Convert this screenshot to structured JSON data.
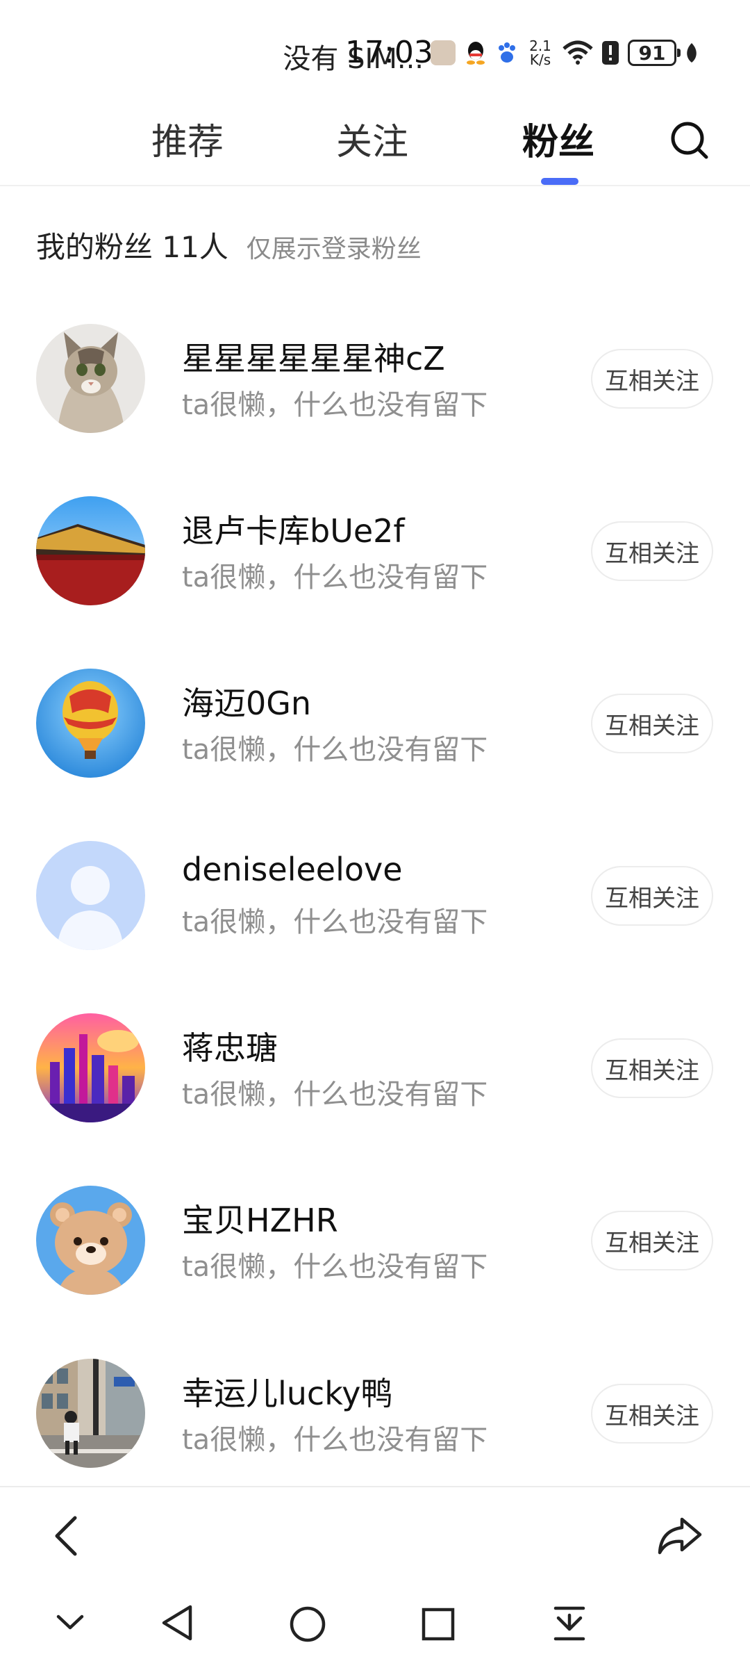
{
  "status_bar": {
    "carrier": "没有 SIM...",
    "time": "17:03",
    "net_speed_value": "2.1",
    "net_speed_unit": "K/s",
    "battery": "91"
  },
  "tabs": [
    {
      "label": "推荐",
      "active": false
    },
    {
      "label": "关注",
      "active": false
    },
    {
      "label": "粉丝",
      "active": true
    }
  ],
  "fans": {
    "title": "我的粉丝 11人",
    "note": "仅展示登录粉丝",
    "button_label": "互相关注",
    "items": [
      {
        "name": "星星星星星星神cZ",
        "bio": "ta很懒，什么也没有留下"
      },
      {
        "name": "退卢卡库bUe2f",
        "bio": "ta很懒，什么也没有留下"
      },
      {
        "name": "海迈0Gn",
        "bio": "ta很懒，什么也没有留下"
      },
      {
        "name": "deniseleelove",
        "bio": "ta很懒，什么也没有留下"
      },
      {
        "name": "蒋忠瑭",
        "bio": "ta很懒，什么也没有留下"
      },
      {
        "name": "宝贝HZHR",
        "bio": "ta很懒，什么也没有留下"
      },
      {
        "name": "幸运儿lucky鸭",
        "bio": "ta很懒，什么也没有留下"
      }
    ]
  },
  "colors": {
    "accent": "#4a6cf7",
    "muted_text": "#8f8f8f",
    "divider": "#ececec"
  },
  "icons": {
    "search": "search-icon",
    "back": "back-chevron-icon",
    "share": "share-icon",
    "nav": [
      "collapse-chevron-icon",
      "nav-back-icon",
      "nav-home-icon",
      "nav-recents-icon",
      "nav-dropdown-icon"
    ]
  }
}
